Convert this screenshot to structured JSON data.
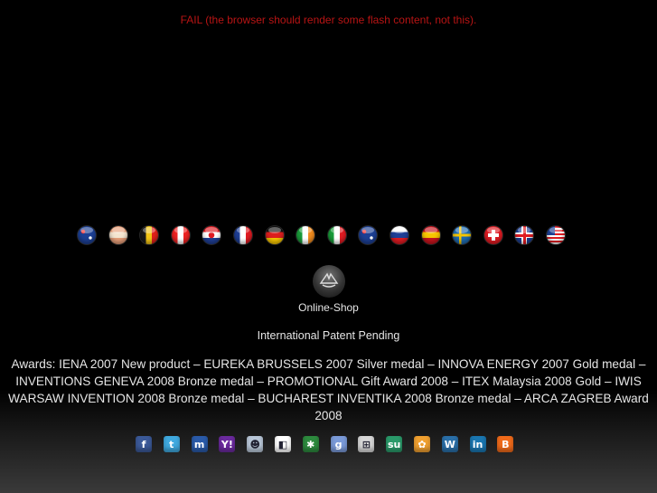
{
  "fail_message": "FAIL (the browser should render some flash content, not this).",
  "flags": [
    {
      "name": "australia",
      "colors": [
        "#1c3f94",
        "#1c3f94"
      ]
    },
    {
      "name": "spain-old",
      "colors": [
        "#e8a07a",
        "#f4e4cf"
      ]
    },
    {
      "name": "belgium",
      "colors": [
        "#1a1a1a",
        "#f2c416",
        "#e0201a"
      ]
    },
    {
      "name": "canada",
      "colors": [
        "#e22",
        "#fff",
        "#e22"
      ]
    },
    {
      "name": "croatia",
      "colors": [
        "#e01b22",
        "#ffffff",
        "#1f3f96"
      ]
    },
    {
      "name": "france",
      "colors": [
        "#1f3f96",
        "#ffffff",
        "#e01b22"
      ]
    },
    {
      "name": "germany",
      "colors": [
        "#111111",
        "#dd1e1e",
        "#f7c600"
      ]
    },
    {
      "name": "ireland",
      "colors": [
        "#1a9c3a",
        "#ffffff",
        "#f28c1e"
      ]
    },
    {
      "name": "italy",
      "colors": [
        "#1a9c3a",
        "#ffffff",
        "#e01b22"
      ]
    },
    {
      "name": "new-zealand",
      "colors": [
        "#1c3f94",
        "#1c3f94"
      ]
    },
    {
      "name": "russia",
      "colors": [
        "#ffffff",
        "#1f3f96",
        "#e01b22"
      ]
    },
    {
      "name": "spain",
      "colors": [
        "#c8141e",
        "#f7c600",
        "#c8141e"
      ]
    },
    {
      "name": "sweden",
      "colors": [
        "#1f6bb0",
        "#f7c600"
      ]
    },
    {
      "name": "switzerland",
      "colors": [
        "#e01b22",
        "#ffffff"
      ]
    },
    {
      "name": "united-kingdom",
      "colors": [
        "#1c3f94",
        "#ffffff",
        "#e01b22"
      ]
    },
    {
      "name": "united-states",
      "colors": [
        "#e01b22",
        "#ffffff",
        "#1c3f94"
      ]
    }
  ],
  "shop": {
    "label": "Online-Shop"
  },
  "patent_text": "International Patent Pending",
  "awards_text": "Awards: IENA 2007 New product – EUREKA BRUSSELS 2007 Silver medal – INNOVA ENERGY 2007 Gold medal – INVENTIONS GENEVA 2008 Bronze medal – PROMOTIONAL Gift Award 2008 – ITEX Malaysia 2008 Gold – IWIS WARSAW INVENTION 2008 Bronze medal – BUCHAREST INVENTIKA 2008 Bronze medal – ARCA ZAGREB Award 2008",
  "social": [
    {
      "name": "facebook-icon",
      "glyph": "f",
      "color": "#3b5998"
    },
    {
      "name": "twitter-icon",
      "glyph": "t",
      "color": "#3fa9df"
    },
    {
      "name": "myspace-icon",
      "glyph": "m",
      "color": "#2a5aa8"
    },
    {
      "name": "yahoo-icon",
      "glyph": "Y!",
      "color": "#6b2a9e"
    },
    {
      "name": "reddit-icon",
      "glyph": "☻",
      "color": "#b9c7d8"
    },
    {
      "name": "delicious-icon",
      "glyph": "◧",
      "color": "#ffffff"
    },
    {
      "name": "evernote-icon",
      "glyph": "✱",
      "color": "#2d8a3e"
    },
    {
      "name": "google-icon",
      "glyph": "g",
      "color": "#7a9ad8"
    },
    {
      "name": "windows-live-icon",
      "glyph": "⊞",
      "color": "#d8d8d8"
    },
    {
      "name": "stumbleupon-icon",
      "glyph": "su",
      "color": "#2a9a6a"
    },
    {
      "name": "mixx-icon",
      "glyph": "✿",
      "color": "#f0a030"
    },
    {
      "name": "wordpress-icon",
      "glyph": "W",
      "color": "#2a6fa8"
    },
    {
      "name": "linkedin-icon",
      "glyph": "in",
      "color": "#1a76b0"
    },
    {
      "name": "blogger-icon",
      "glyph": "B",
      "color": "#f06a1a"
    }
  ]
}
